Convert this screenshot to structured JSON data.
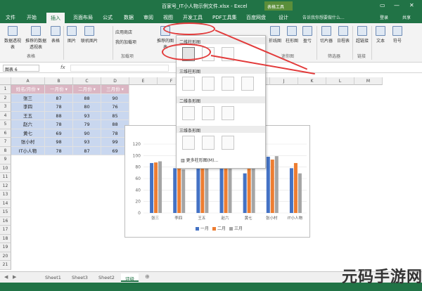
{
  "title_bar": {
    "title": "百家号_IT小人物示例文件.xlsx - Excel",
    "context_tab": "表格工具"
  },
  "tabs": [
    "文件",
    "开始",
    "插入",
    "页面布局",
    "公式",
    "数据",
    "审阅",
    "视图",
    "开发工具",
    "PDF工具集",
    "百度网盘",
    "设计"
  ],
  "active_tab": "插入",
  "tell_me": "告诉我你想要做什么...",
  "login_label": "登录",
  "share_label": "共享",
  "ribbon": {
    "buttons": [
      "数据透视表",
      "推荐的数据透视表",
      "表格",
      "图片",
      "联机图片",
      "应用商店",
      "我的加载项",
      "推荐的图表",
      "折线图",
      "柱形图",
      "盈亏",
      "切片器",
      "日程表",
      "超链接",
      "文本",
      "符号"
    ],
    "groups": [
      "表格",
      "加载项",
      "迷你图",
      "筛选器",
      "链接"
    ]
  },
  "name_box": "图表 6",
  "fx_label": "fx",
  "columns": [
    "A",
    "B",
    "C",
    "D",
    "E",
    "F",
    "G",
    "H",
    "I",
    "J",
    "K",
    "L",
    "M"
  ],
  "rows": [
    "1",
    "2",
    "3",
    "4",
    "5",
    "6",
    "7",
    "8",
    "9",
    "10",
    "11",
    "12",
    "13",
    "14",
    "15",
    "16",
    "17",
    "18",
    "19",
    "20",
    "21"
  ],
  "table": {
    "headers": [
      "姓名/月份",
      "一月份",
      "二月份",
      "三月份"
    ],
    "rows": [
      [
        "张三",
        "87",
        "88",
        "90"
      ],
      [
        "李四",
        "78",
        "80",
        "76"
      ],
      [
        "王五",
        "88",
        "93",
        "85"
      ],
      [
        "赵六",
        "78",
        "79",
        "88"
      ],
      [
        "黄七",
        "69",
        "90",
        "78"
      ],
      [
        "张小村",
        "98",
        "93",
        "99"
      ],
      [
        "IT小人物",
        "78",
        "87",
        "69"
      ]
    ]
  },
  "chart_menu": {
    "sections": [
      "二维柱形图",
      "三维柱形图",
      "二维条形图",
      "三维条形图"
    ],
    "more_label": "更多柱形图(M)..."
  },
  "chart_data": {
    "type": "bar",
    "categories": [
      "张三",
      "李四",
      "王五",
      "赵六",
      "黄七",
      "张小村",
      "IT小人物"
    ],
    "series": [
      {
        "name": "一月",
        "values": [
          87,
          78,
          88,
          78,
          69,
          98,
          78
        ],
        "color": "#4472c4"
      },
      {
        "name": "二月",
        "values": [
          88,
          80,
          93,
          79,
          90,
          93,
          87
        ],
        "color": "#ed7d31"
      },
      {
        "name": "三月",
        "values": [
          90,
          76,
          85,
          88,
          78,
          99,
          69
        ],
        "color": "#a5a5a5"
      }
    ],
    "y_ticks": [
      "0",
      "20",
      "40",
      "60",
      "80",
      "100",
      "120"
    ],
    "ylim": [
      0,
      120
    ],
    "legend": "bottom"
  },
  "sheet_tabs": [
    "Sheet1",
    "Sheet3",
    "Sheet2",
    "评级"
  ],
  "active_sheet": "评级",
  "watermark": "元码手游网",
  "colors": {
    "excel_green": "#217346",
    "header_fill": "#dbb6c3",
    "data_fill": "#c9d7ef",
    "annotation_red": "#e23a3a"
  }
}
